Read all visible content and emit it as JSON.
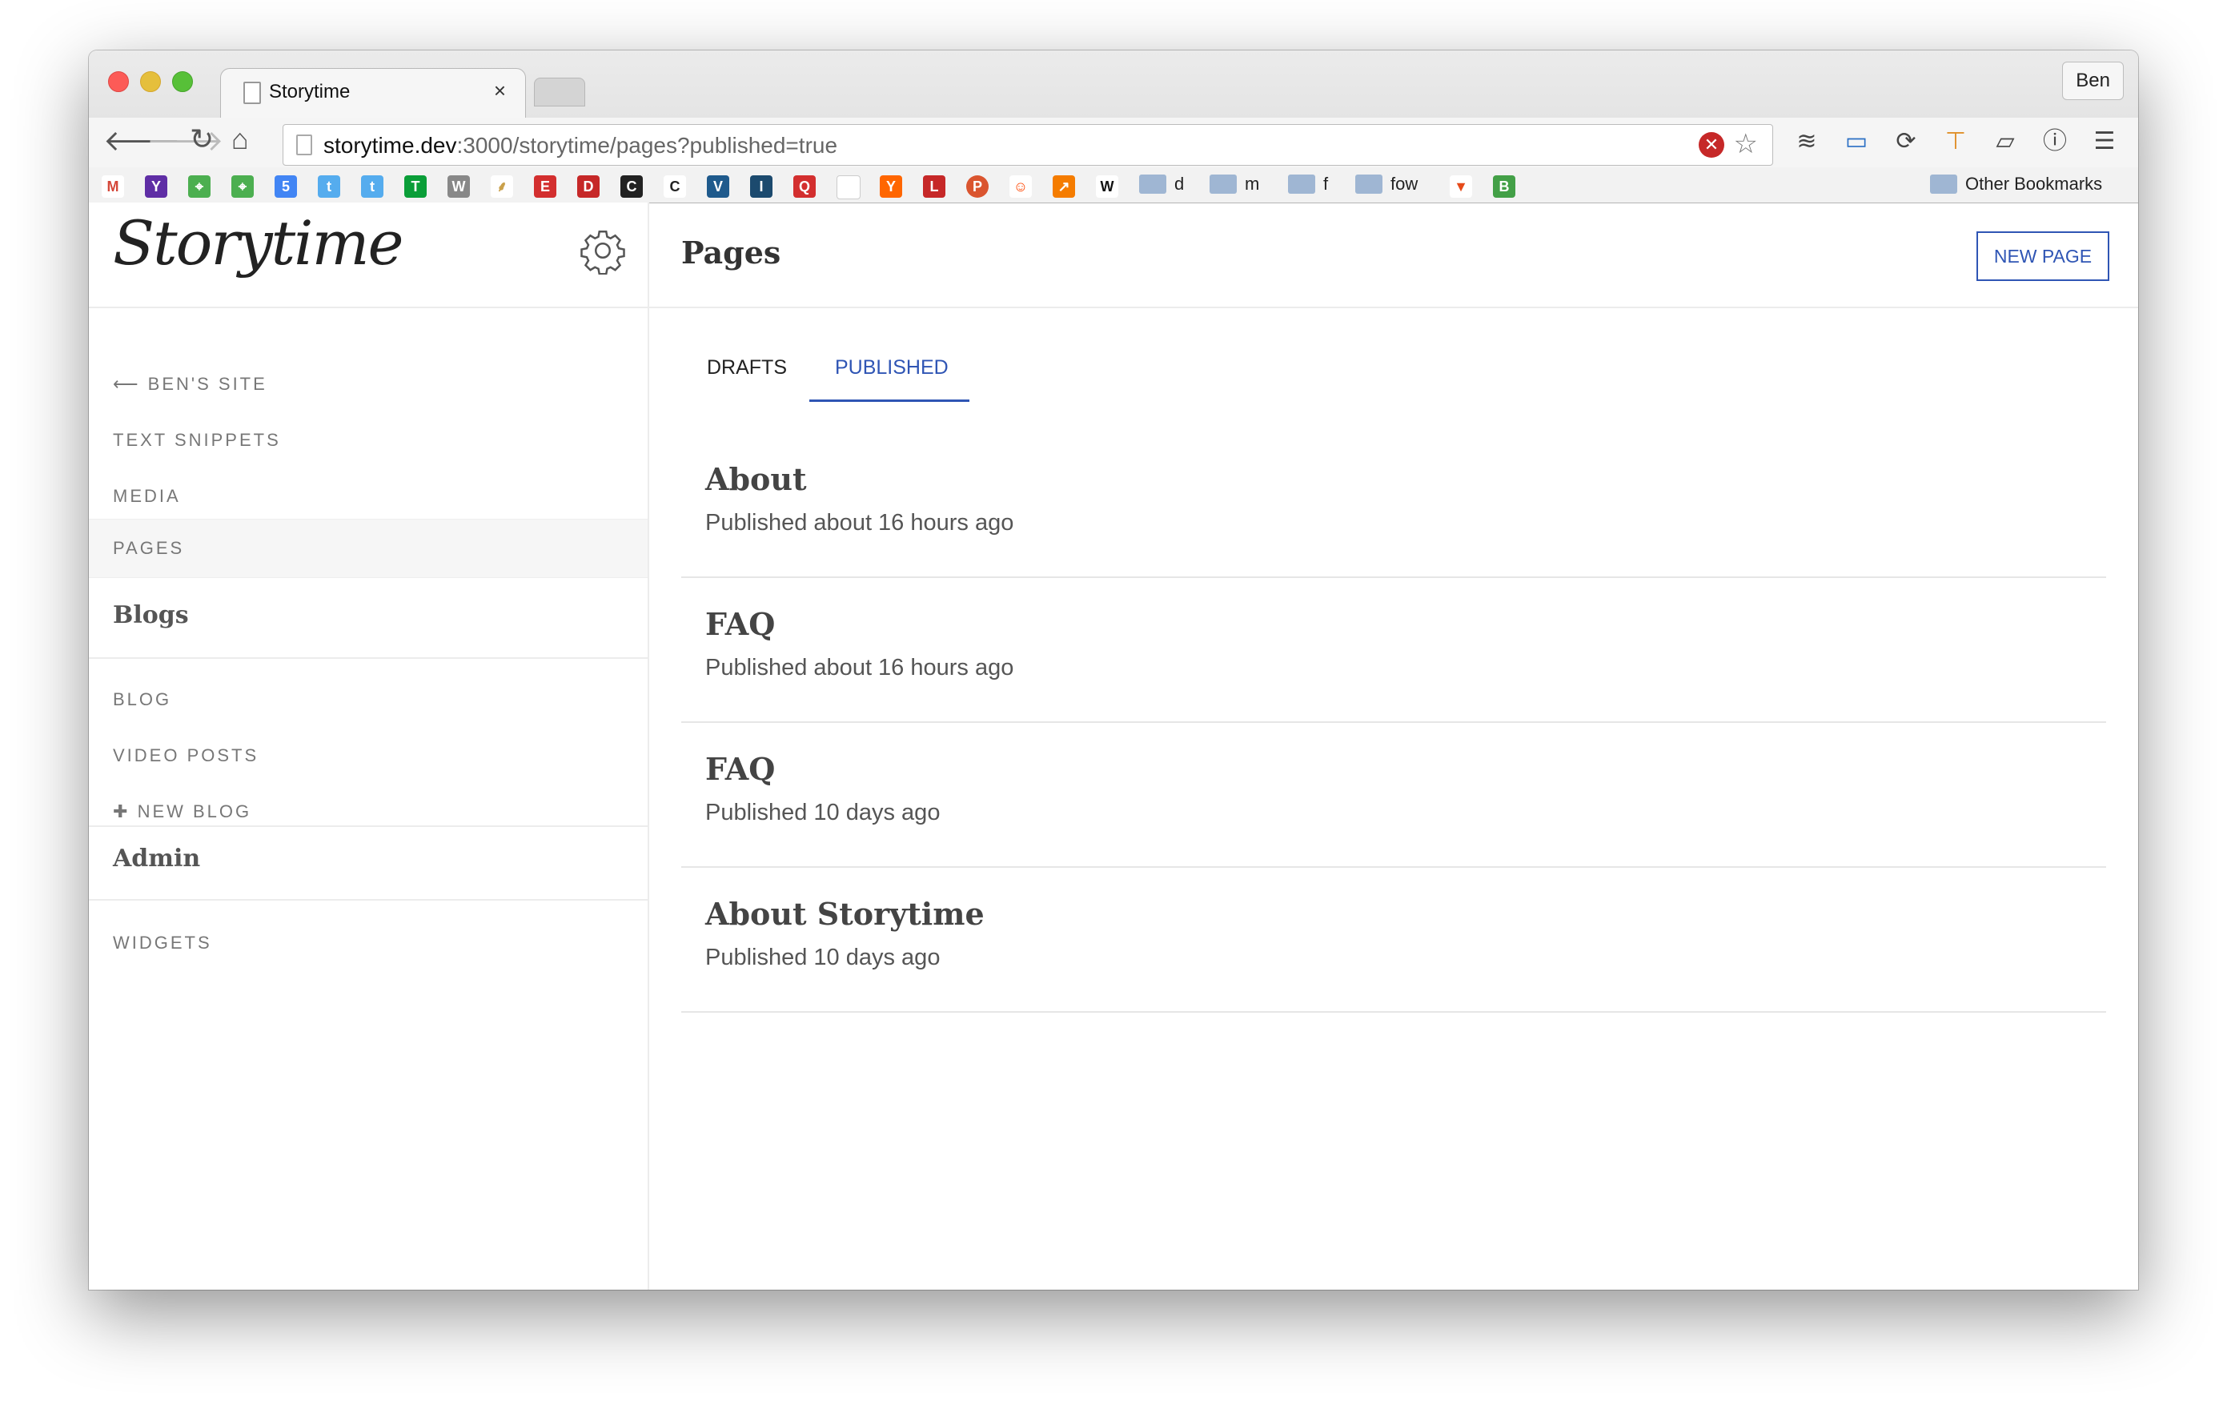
{
  "browser": {
    "tab_title": "Storytime",
    "tab_close": "×",
    "profile_name": "Ben",
    "url_host": "storytime.dev",
    "url_rest": ":3000/storytime/pages?published=true"
  },
  "bookmarks": {
    "folders": [
      "d",
      "m",
      "f",
      "fow"
    ],
    "other_label": "Other Bookmarks"
  },
  "sidebar": {
    "logo": "Storytime",
    "back_arrow": "⟵",
    "back_label": "BEN'S SITE",
    "items_top": [
      "TEXT SNIPPETS",
      "MEDIA",
      "PAGES"
    ],
    "blogs_heading": "Blogs",
    "blog_items": [
      "BLOG",
      "VIDEO POSTS"
    ],
    "new_blog_plus": "✚",
    "new_blog_label": "NEW BLOG",
    "admin_heading": "Admin",
    "admin_items": [
      "WIDGETS"
    ]
  },
  "main": {
    "title": "Pages",
    "new_button": "NEW PAGE",
    "tabs": [
      {
        "label": "DRAFTS",
        "active": false
      },
      {
        "label": "PUBLISHED",
        "active": true
      }
    ],
    "pages": [
      {
        "title": "About",
        "status": "Published about 16 hours ago"
      },
      {
        "title": "FAQ",
        "status": "Published about 16 hours ago"
      },
      {
        "title": "FAQ",
        "status": "Published 10 days ago"
      },
      {
        "title": "About Storytime",
        "status": "Published 10 days ago"
      }
    ]
  },
  "colors": {
    "accent": "#2f55b4",
    "sidebar_active_bg": "#f6f6f6",
    "divider": "#ececec"
  }
}
